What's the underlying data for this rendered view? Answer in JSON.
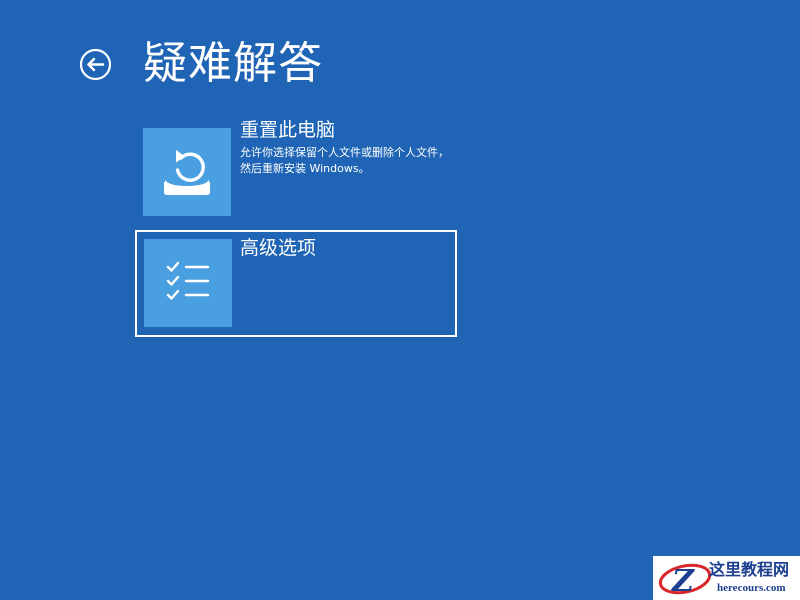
{
  "header": {
    "title": "疑难解答",
    "back_icon": "back-arrow-circle-icon"
  },
  "options": [
    {
      "title": "重置此电脑",
      "description": "允许你选择保留个人文件或删除个人文件，然后重新安装 Windows。",
      "icon": "reset-pc-icon",
      "focused": false
    },
    {
      "title": "高级选项",
      "description": "",
      "icon": "checklist-icon",
      "focused": true
    }
  ],
  "watermark": {
    "name": "这里教程网",
    "url": "herecours.com",
    "logo_letter": "Z"
  },
  "colors": {
    "background": "#1f64b5",
    "tile": "#4a9fe0",
    "text": "#ffffff",
    "watermark_text": "#1c3f8f",
    "watermark_accent": "#d8262b"
  }
}
